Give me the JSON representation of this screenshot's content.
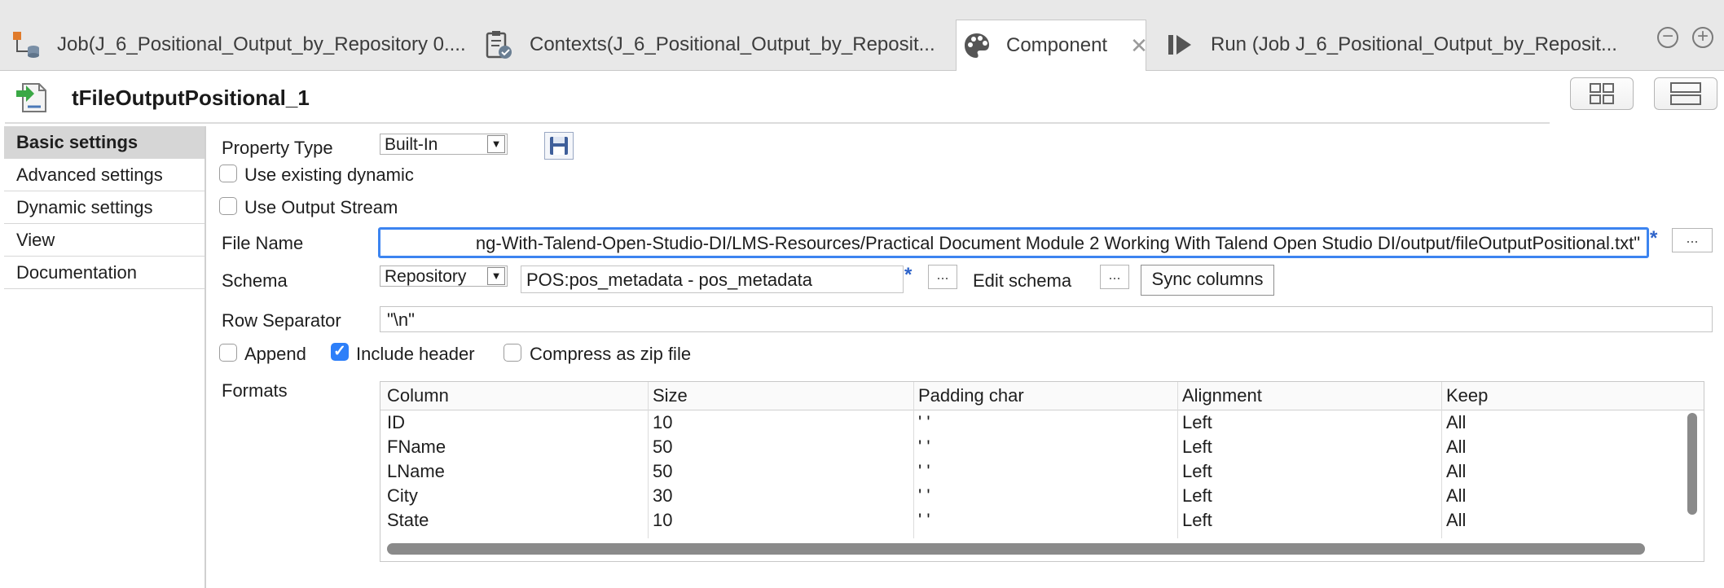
{
  "tabs": [
    {
      "label": "Job(J_6_Positional_Output_by_Repository 0....",
      "icon": "job-icon",
      "active": false
    },
    {
      "label": "Contexts(J_6_Positional_Output_by_Reposit...",
      "icon": "clipboard-check-icon",
      "active": false
    },
    {
      "label": "Component",
      "icon": "palette-icon",
      "active": true
    },
    {
      "label": "Run (Job J_6_Positional_Output_by_Reposit...",
      "icon": "run-icon",
      "active": false
    }
  ],
  "component": {
    "title": "tFileOutputPositional_1",
    "icon": "file-output-icon"
  },
  "nav": {
    "items": [
      {
        "label": "Basic settings",
        "selected": true
      },
      {
        "label": "Advanced settings",
        "selected": false
      },
      {
        "label": "Dynamic settings",
        "selected": false
      },
      {
        "label": "View",
        "selected": false
      },
      {
        "label": "Documentation",
        "selected": false
      }
    ]
  },
  "form": {
    "property_type_label": "Property Type",
    "property_type_value": "Built-In",
    "use_existing_dynamic_label": "Use existing dynamic",
    "use_existing_dynamic_checked": false,
    "use_output_stream_label": "Use Output Stream",
    "use_output_stream_checked": false,
    "file_name_label": "File Name",
    "file_name_value": "ng-With-Talend-Open-Studio-DI/LMS-Resources/Practical Document Module 2 Working With Talend Open Studio DI/output/fileOutputPositional.txt\"",
    "required_marker": "*",
    "dots_label": "...",
    "schema_label": "Schema",
    "schema_type": "Repository",
    "schema_value": "POS:pos_metadata - pos_metadata",
    "edit_schema_label": "Edit schema",
    "sync_columns_label": "Sync columns",
    "row_separator_label": "Row Separator",
    "row_separator_value": "\"\\n\"",
    "append_label": "Append",
    "append_checked": false,
    "include_header_label": "Include header",
    "include_header_checked": true,
    "compress_label": "Compress as zip file",
    "compress_checked": false,
    "formats_label": "Formats"
  },
  "formats_table": {
    "columns": [
      "Column",
      "Size",
      "Padding char",
      "Alignment",
      "Keep"
    ],
    "rows": [
      [
        "ID",
        "10",
        "' '",
        "Left",
        "All"
      ],
      [
        "FName",
        "50",
        "' '",
        "Left",
        "All"
      ],
      [
        "LName",
        "50",
        "' '",
        "Left",
        "All"
      ],
      [
        "City",
        "30",
        "' '",
        "Left",
        "All"
      ],
      [
        "State",
        "10",
        "' '",
        "Left",
        "All"
      ]
    ]
  },
  "colors": {
    "accent": "#3c84f0",
    "checkbox_checked": "#2d7ff9",
    "tabbar_bg": "#e8e8e8"
  }
}
